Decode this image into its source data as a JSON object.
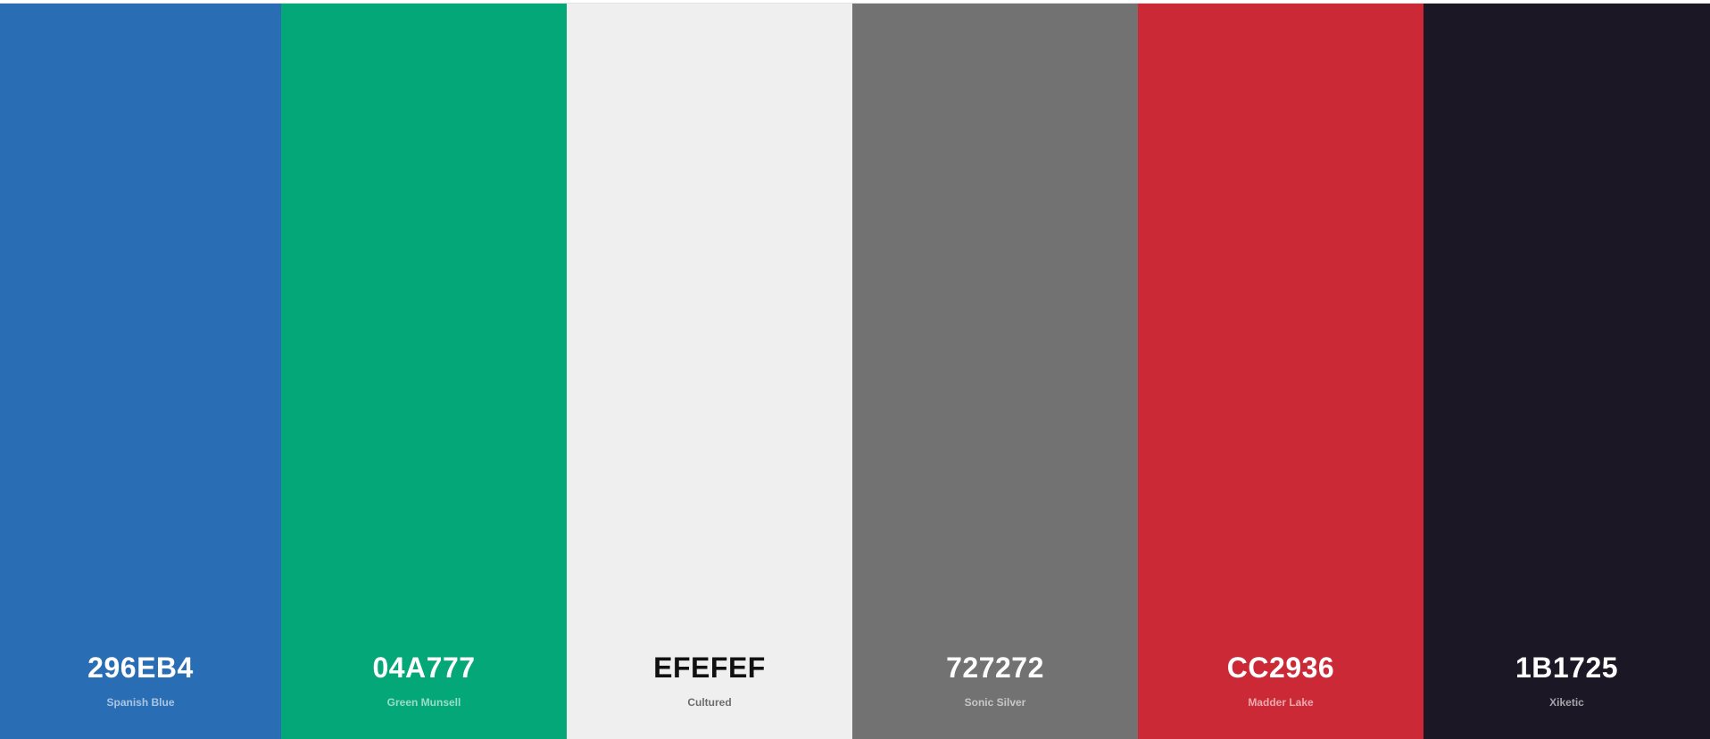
{
  "palette": {
    "swatches": [
      {
        "hex": "296EB4",
        "name": "Spanish Blue",
        "color": "#296EB4",
        "text_tone": "light"
      },
      {
        "hex": "04A777",
        "name": "Green Munsell",
        "color": "#04A777",
        "text_tone": "light"
      },
      {
        "hex": "EFEFEF",
        "name": "Cultured",
        "color": "#EFEFEF",
        "text_tone": "dark"
      },
      {
        "hex": "727272",
        "name": "Sonic Silver",
        "color": "#727272",
        "text_tone": "light"
      },
      {
        "hex": "CC2936",
        "name": "Madder Lake",
        "color": "#CC2936",
        "text_tone": "light"
      },
      {
        "hex": "1B1725",
        "name": "Xiketic",
        "color": "#1B1725",
        "text_tone": "light"
      }
    ]
  }
}
